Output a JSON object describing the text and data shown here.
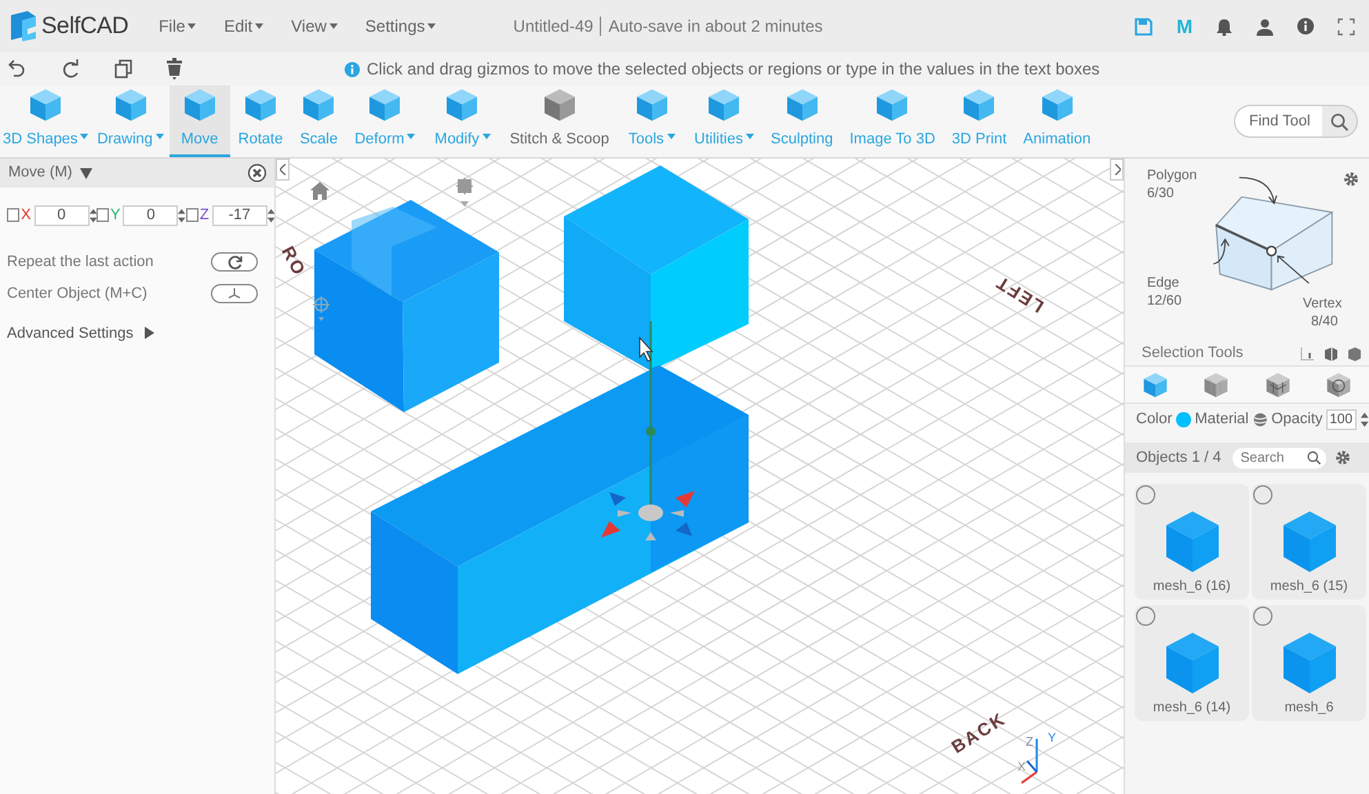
{
  "app": {
    "name": "SelfCAD"
  },
  "menus": [
    {
      "label": "File"
    },
    {
      "label": "Edit"
    },
    {
      "label": "View"
    },
    {
      "label": "Settings"
    }
  ],
  "document": {
    "title": "Untitled-49",
    "autosave": "Auto-save in about 2 minutes"
  },
  "account_badge": "M",
  "hint": "Click and drag gizmos to move the selected objects or regions or type in the values in the text boxes",
  "tools": [
    {
      "label": "3D Shapes",
      "dropdown": true,
      "selected": false,
      "disabled": false
    },
    {
      "label": "Drawing",
      "dropdown": true,
      "selected": false,
      "disabled": false
    },
    {
      "label": "Move",
      "dropdown": false,
      "selected": true,
      "disabled": false
    },
    {
      "label": "Rotate",
      "dropdown": false,
      "selected": false,
      "disabled": false
    },
    {
      "label": "Scale",
      "dropdown": false,
      "selected": false,
      "disabled": false
    },
    {
      "label": "Deform",
      "dropdown": true,
      "selected": false,
      "disabled": false
    },
    {
      "label": "Modify",
      "dropdown": true,
      "selected": false,
      "disabled": false
    },
    {
      "label": "Stitch & Scoop",
      "dropdown": false,
      "selected": false,
      "disabled": true
    },
    {
      "label": "Tools",
      "dropdown": true,
      "selected": false,
      "disabled": false
    },
    {
      "label": "Utilities",
      "dropdown": true,
      "selected": false,
      "disabled": false
    },
    {
      "label": "Sculpting",
      "dropdown": false,
      "selected": false,
      "disabled": false
    },
    {
      "label": "Image To 3D",
      "dropdown": false,
      "selected": false,
      "disabled": false
    },
    {
      "label": "3D Print",
      "dropdown": false,
      "selected": false,
      "disabled": false
    },
    {
      "label": "Animation",
      "dropdown": false,
      "selected": false,
      "disabled": false
    }
  ],
  "find_tool": {
    "placeholder": "Find Tool"
  },
  "move_panel": {
    "title": "Move (M)",
    "axes": [
      {
        "label": "X",
        "color": "#e53935",
        "checked": false,
        "value": "0"
      },
      {
        "label": "Y",
        "color": "#2bb673",
        "checked": false,
        "value": "0"
      },
      {
        "label": "Z",
        "color": "#7b4fd0",
        "checked": false,
        "value": "-17"
      }
    ],
    "actions": [
      {
        "label": "Repeat the last action",
        "kind": "repeat"
      },
      {
        "label": "Center Object (M+C)",
        "kind": "center"
      }
    ],
    "advanced": "Advanced Settings"
  },
  "viewport": {
    "labels": [
      {
        "text": "RO",
        "kind": "front"
      },
      {
        "text": "LEFT",
        "kind": "left"
      },
      {
        "text": "BACK",
        "kind": "back"
      }
    ],
    "axes": [
      {
        "text": "Z",
        "kind": "z"
      },
      {
        "text": "Y",
        "kind": "y"
      },
      {
        "text": "X",
        "kind": "x"
      }
    ]
  },
  "selection": {
    "polygon": {
      "label": "Polygon",
      "count": "6/30"
    },
    "edge": {
      "label": "Edge",
      "count": "12/60"
    },
    "vertex": {
      "label": "Vertex",
      "count": "8/40"
    },
    "tools_label": "Selection Tools",
    "modes": [
      {
        "selected": true
      },
      {
        "selected": false
      },
      {
        "selected": false
      },
      {
        "selected": false
      }
    ]
  },
  "appearance": {
    "color_label": "Color",
    "color": "#00bfff",
    "material_label": "Material",
    "opacity_label": "Opacity",
    "opacity": "100"
  },
  "objects": {
    "title": "Objects 1 / 4",
    "search_placeholder": "Search",
    "items": [
      {
        "name": "mesh_6 (16)",
        "selected": false
      },
      {
        "name": "mesh_6 (15)",
        "selected": false
      },
      {
        "name": "mesh_6 (14)",
        "selected": false
      },
      {
        "name": "mesh_6",
        "selected": false
      }
    ]
  }
}
